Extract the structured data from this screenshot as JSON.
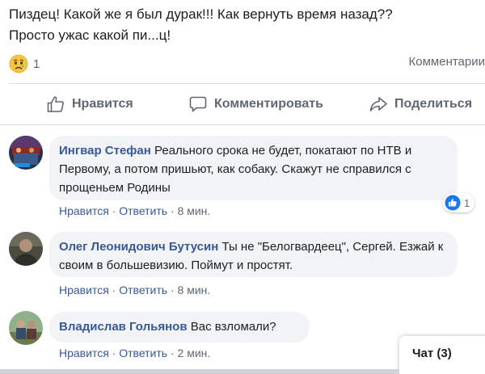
{
  "post": {
    "text_line1": "Пиздец! Какой же я был дурак!!! Как вернуть время назад??",
    "text_line2": "Просто ужас какой пи...ц!",
    "reaction_icon": "sad-emoji-icon",
    "reaction_count": "1",
    "comments_link": "Комментарии"
  },
  "actions": {
    "like_label": "Нравится",
    "comment_label": "Комментировать",
    "share_label": "Поделиться"
  },
  "comments": [
    {
      "author": "Ингвар Стефан",
      "text": "Реального срока не будет, покатают по НТВ и Первому, а потом пришьют, как собаку. Скажут не справился с прощеньем Родины",
      "like": "Нравится",
      "reply": "Ответить",
      "time": "8 мин.",
      "likes_count": "1"
    },
    {
      "author": "Олег Леонидович Бутусин",
      "text": "Ты не \"Белогвардеец\", Сергей. Езжай к своим в большевизию. Поймут и простят.",
      "like": "Нравится",
      "reply": "Ответить",
      "time": "8 мин."
    },
    {
      "author": "Владислав Гольянов",
      "text": "Вас взломали?",
      "like": "Нравится",
      "reply": "Ответить",
      "time": "2 мин."
    }
  ],
  "chat": {
    "label": "Чат (3)"
  },
  "colors": {
    "link": "#385898",
    "muted": "#606770",
    "bubble": "#f2f3f5",
    "like_blue": "#1877f2"
  }
}
